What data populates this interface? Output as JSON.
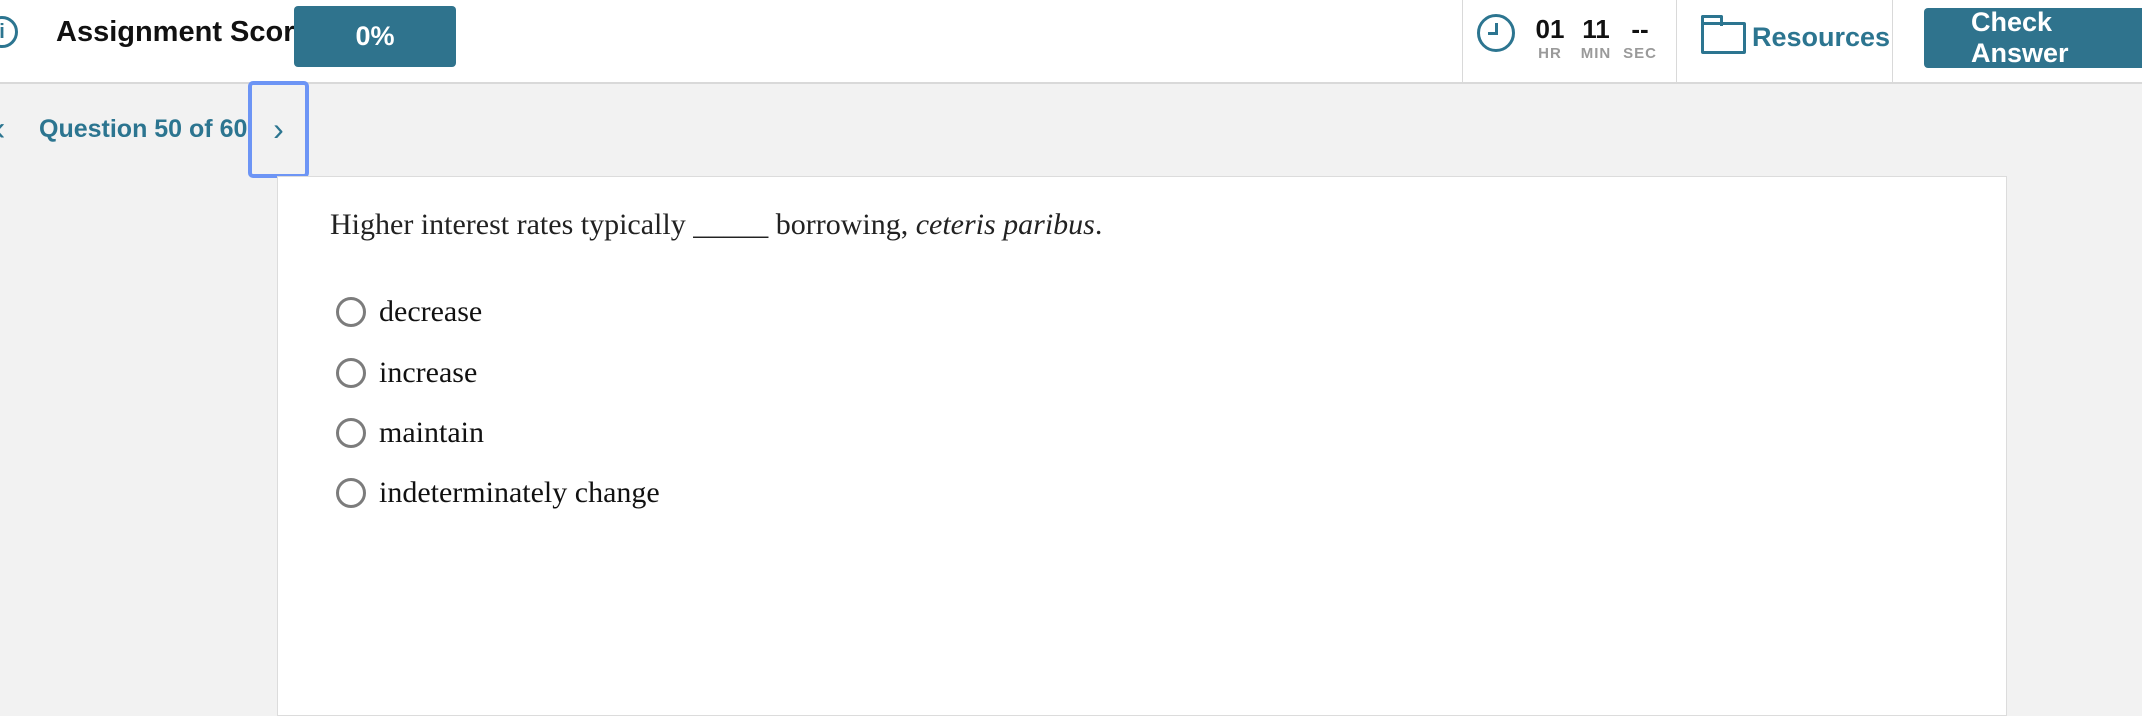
{
  "header": {
    "score_label": "Assignment Score:",
    "score_value": "0%",
    "timer": {
      "hours": "01",
      "hours_unit": "HR",
      "minutes": "11",
      "minutes_unit": "MIN",
      "seconds": "--",
      "seconds_unit": "SEC"
    },
    "resources_label": "Resources",
    "check_answer_label": "Check Answer"
  },
  "nav": {
    "question_counter": "Question 50 of 60"
  },
  "question": {
    "text_before": "Higher interest rates typically _____ borrowing, ",
    "text_italic": "ceteris paribus",
    "text_after": ".",
    "options": [
      {
        "label": "decrease"
      },
      {
        "label": "increase"
      },
      {
        "label": "maintain"
      },
      {
        "label": "indeterminately change"
      }
    ]
  },
  "colors": {
    "accent": "#2f738d",
    "focus_outline": "#6d95f5",
    "page_background": "#f2f2f2"
  }
}
